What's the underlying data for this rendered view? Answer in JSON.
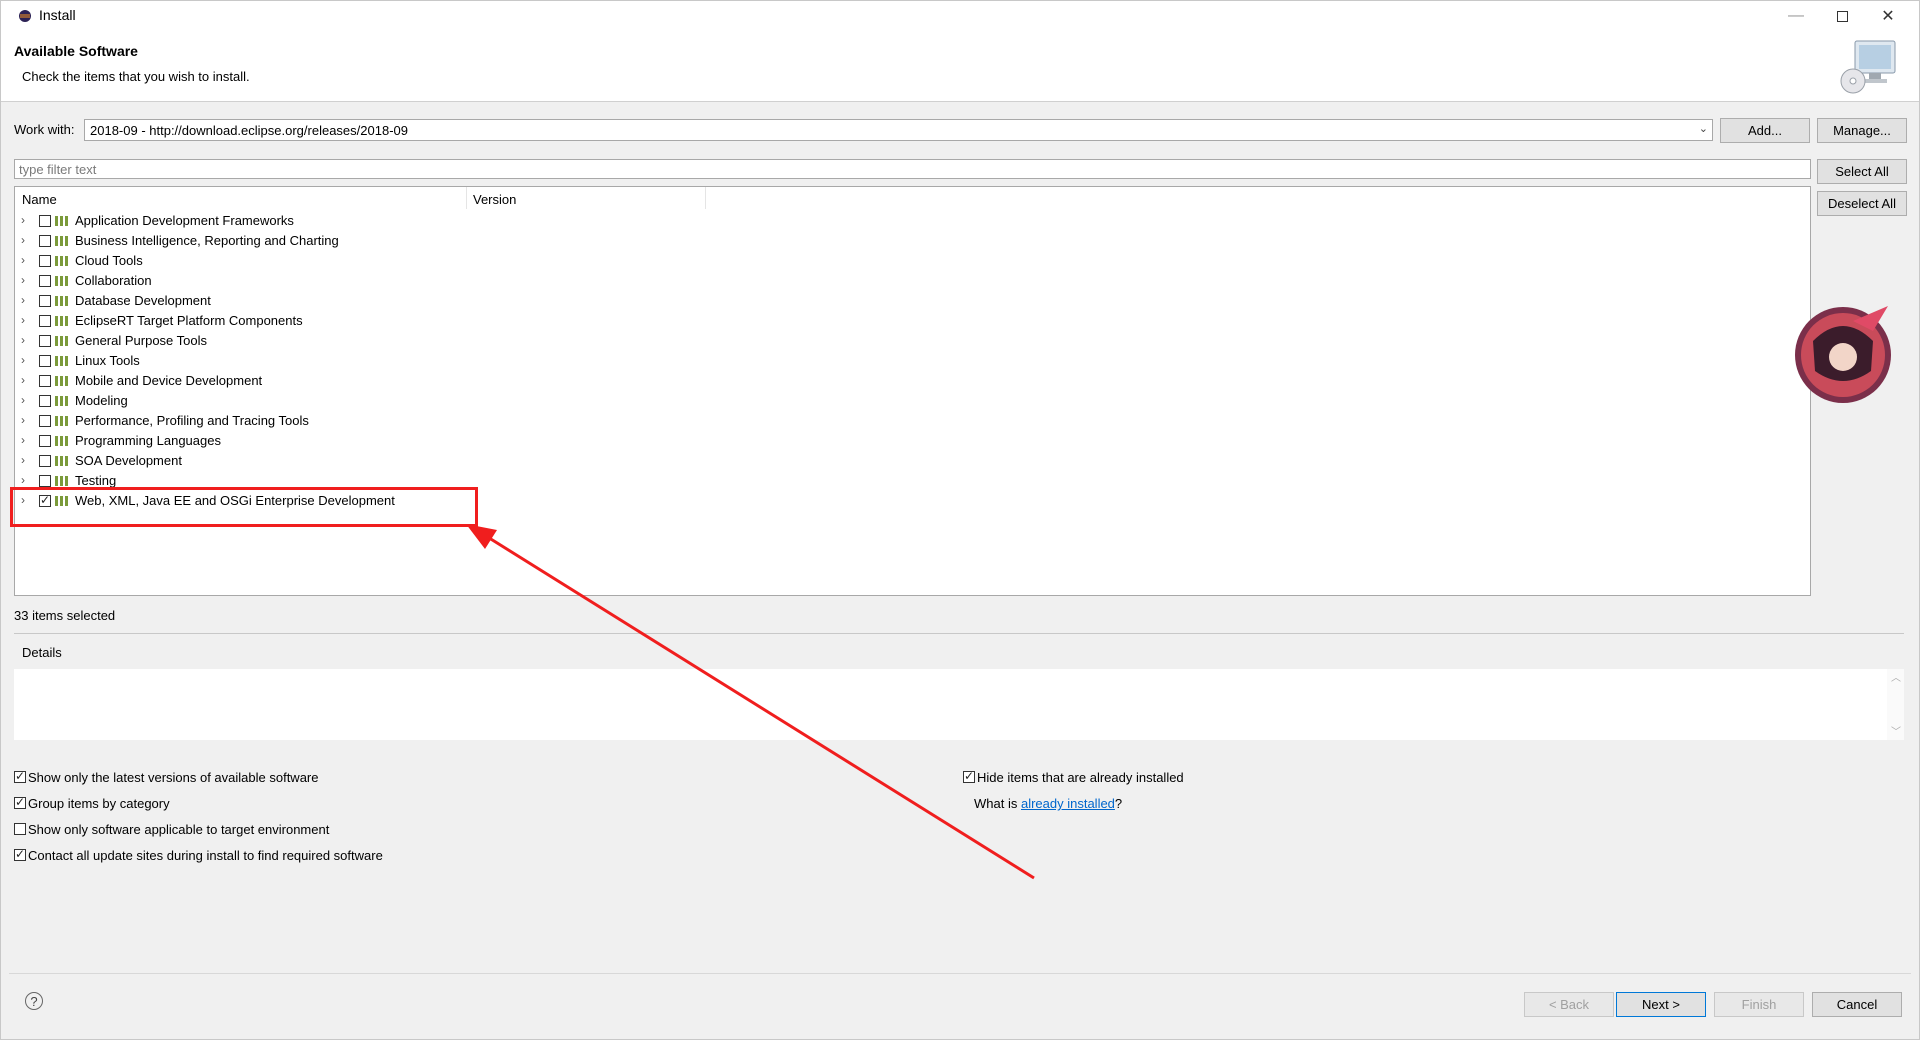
{
  "window": {
    "title": "Install"
  },
  "banner": {
    "heading": "Available Software",
    "subtitle": "Check the items that you wish to install."
  },
  "work_with": {
    "label": "Work with:",
    "value": "2018-09 - http://download.eclipse.org/releases/2018-09",
    "add_label": "Add...",
    "manage_label": "Manage..."
  },
  "filter": {
    "placeholder": "type filter text"
  },
  "side_buttons": {
    "select_all": "Select All",
    "deselect_all": "Deselect All"
  },
  "tree": {
    "columns": [
      "Name",
      "Version"
    ],
    "items": [
      {
        "label": "Application Development Frameworks",
        "checked": false
      },
      {
        "label": "Business Intelligence, Reporting and Charting",
        "checked": false
      },
      {
        "label": "Cloud Tools",
        "checked": false
      },
      {
        "label": "Collaboration",
        "checked": false
      },
      {
        "label": "Database Development",
        "checked": false
      },
      {
        "label": "EclipseRT Target Platform Components",
        "checked": false
      },
      {
        "label": "General Purpose Tools",
        "checked": false
      },
      {
        "label": "Linux Tools",
        "checked": false
      },
      {
        "label": "Mobile and Device Development",
        "checked": false
      },
      {
        "label": "Modeling",
        "checked": false
      },
      {
        "label": "Performance, Profiling and Tracing Tools",
        "checked": false
      },
      {
        "label": "Programming Languages",
        "checked": false
      },
      {
        "label": "SOA Development",
        "checked": false
      },
      {
        "label": "Testing",
        "checked": false
      },
      {
        "label": "Web, XML, Java EE and OSGi Enterprise Development",
        "checked": true
      }
    ]
  },
  "status": {
    "selected_count": "33 items selected"
  },
  "details": {
    "label": "Details"
  },
  "options": {
    "latest_versions": {
      "label": "Show only the latest versions of available software",
      "checked": true
    },
    "group_by_category": {
      "label": "Group items by category",
      "checked": true
    },
    "target_env": {
      "label": "Show only software applicable to target environment",
      "checked": false
    },
    "contact_sites": {
      "label": "Contact all update sites during install to find required software",
      "checked": true
    },
    "hide_installed": {
      "label": "Hide items that are already installed",
      "checked": true
    },
    "what_is_prefix": "What is ",
    "what_is_link": "already installed",
    "what_is_suffix": "?"
  },
  "footer": {
    "help": "?",
    "back": "< Back",
    "next": "Next >",
    "finish": "Finish",
    "cancel": "Cancel"
  },
  "colors": {
    "annotation": "#f01e1e",
    "link": "#0066cc",
    "default_button_border": "#0078d7"
  }
}
